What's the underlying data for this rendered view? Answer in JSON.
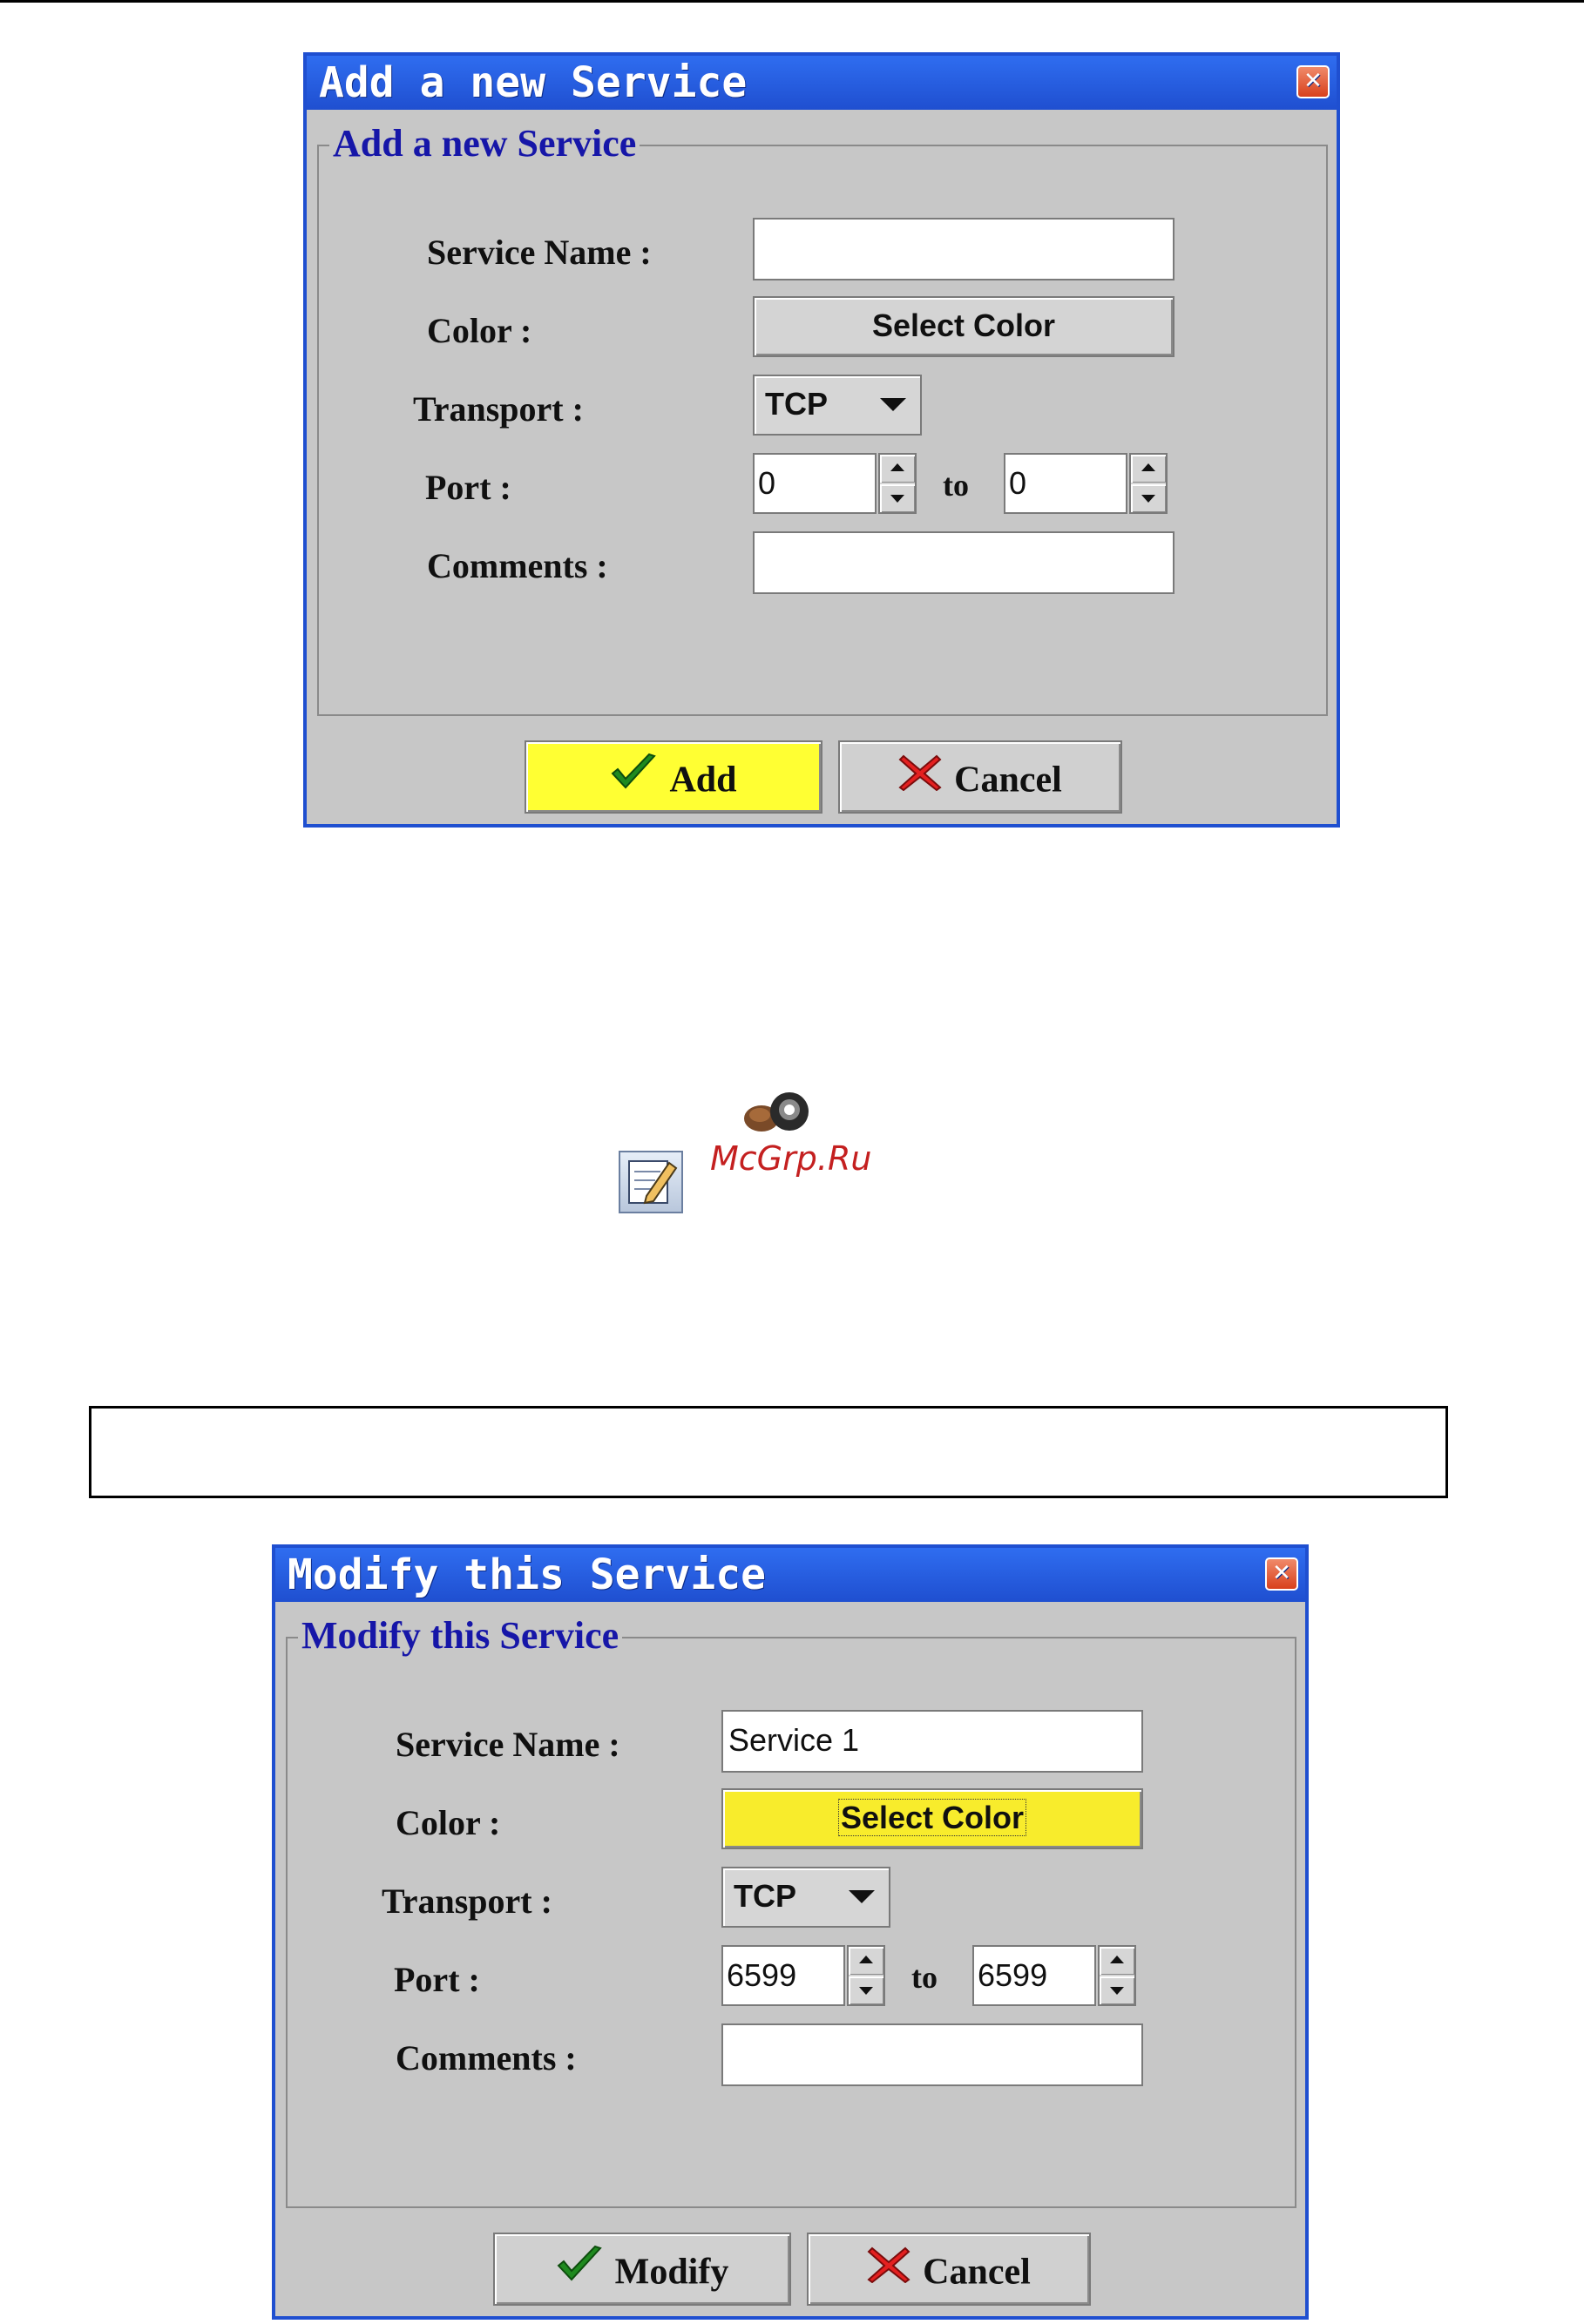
{
  "add_dialog": {
    "title": "Add a new Service",
    "group_title": "Add a new Service",
    "service_name_label": "Service Name :",
    "service_name_value": "",
    "color_label": "Color :",
    "select_color_label": "Select Color",
    "selected_color": "#d4d4d4",
    "transport_label": "Transport :",
    "transport_value": "TCP",
    "port_label": "Port :",
    "port_from": "0",
    "port_to_label": "to",
    "port_to": "0",
    "comments_label": "Comments :",
    "comments_value": "",
    "primary_button": "Add",
    "cancel_button": "Cancel"
  },
  "middle": {
    "watermark": "McGrp.Ru"
  },
  "modify_dialog": {
    "title": "Modify this Service",
    "group_title": "Modify this Service",
    "service_name_label": "Service Name :",
    "service_name_value": "Service 1",
    "color_label": "Color :",
    "select_color_label": "Select Color",
    "selected_color": "#f8ec2c",
    "transport_label": "Transport :",
    "transport_value": "TCP",
    "port_label": "Port :",
    "port_from": "6599",
    "port_to_label": "to",
    "port_to": "6599",
    "comments_label": "Comments :",
    "comments_value": "",
    "primary_button": "Modify",
    "cancel_button": "Cancel"
  },
  "colors": {
    "titlebar": "#1f4fd0",
    "dialog_bg": "#c7c7c7",
    "group_title": "#1616a8",
    "add_button_bg": "#ffff33",
    "watermark": "#c42020"
  },
  "icons": {
    "close": "close-icon",
    "check": "checkmark-icon",
    "cancel": "x-icon",
    "edit": "edit-note-icon",
    "logo": "coffee-logo-icon"
  }
}
